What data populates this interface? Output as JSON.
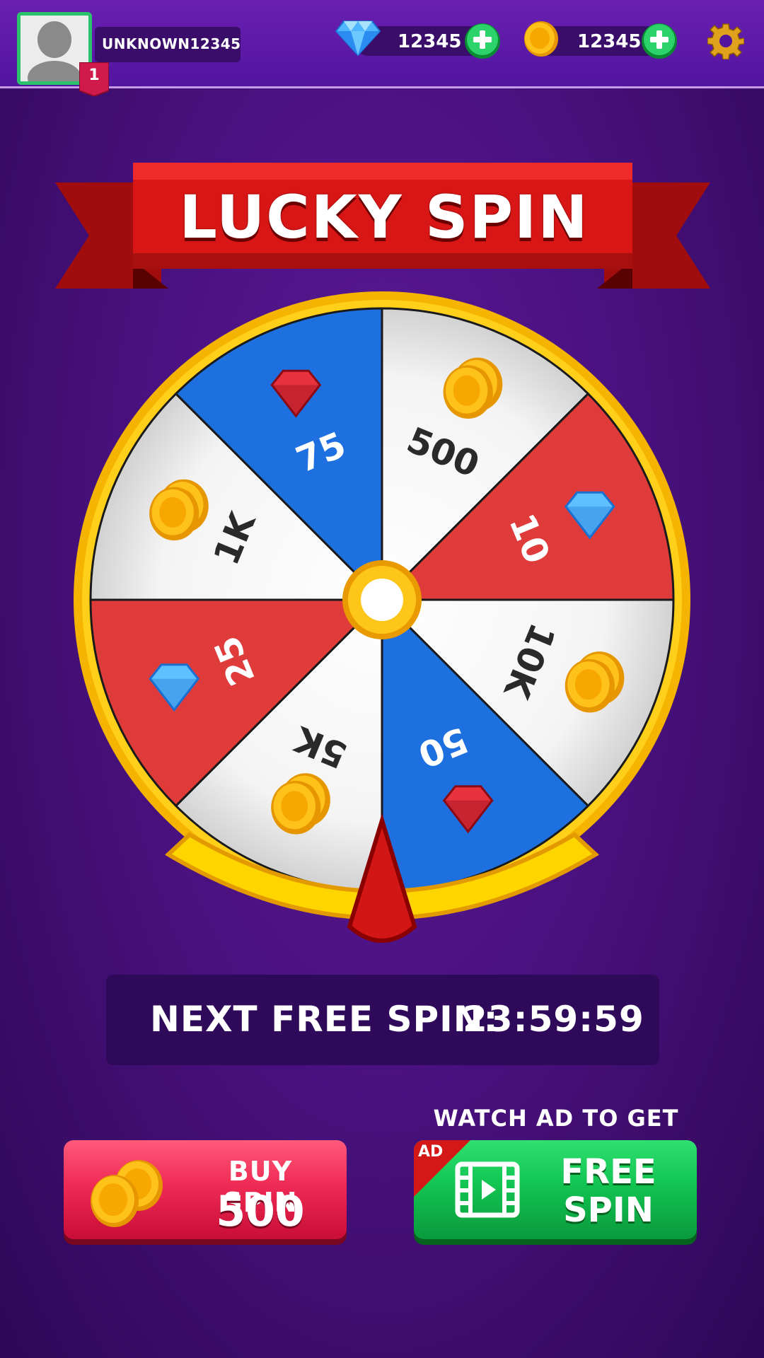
{
  "player": {
    "name": "UNKNOWN12345",
    "level": "1"
  },
  "currencies": {
    "gems": "12345",
    "coins": "12345"
  },
  "icons": {
    "gem": "diamond-icon",
    "coin": "coin-icon",
    "add": "plus-icon",
    "settings": "gear-icon",
    "video": "video-icon"
  },
  "banner": {
    "title": "LUCKY SPIN"
  },
  "wheel": {
    "segments": [
      {
        "label": "500",
        "reward": "coins",
        "color": "#ffffff"
      },
      {
        "label": "10",
        "reward": "gems",
        "color": "#e03b3b"
      },
      {
        "label": "10K",
        "reward": "coins",
        "color": "#ffffff"
      },
      {
        "label": "50",
        "reward": "rubies",
        "color": "#1e6fe0"
      },
      {
        "label": "5K",
        "reward": "coins",
        "color": "#ffffff"
      },
      {
        "label": "25",
        "reward": "gems",
        "color": "#e03b3b"
      },
      {
        "label": "1K",
        "reward": "coins",
        "color": "#ffffff"
      },
      {
        "label": "75",
        "reward": "rubies",
        "color": "#1e6fe0"
      }
    ]
  },
  "timer": {
    "label": "NEXT FREE SPIN:",
    "value": "23:59:59"
  },
  "buy_spin": {
    "label": "BUY SPIN",
    "price": "500"
  },
  "ad_spin": {
    "caption": "WATCH AD TO GET",
    "badge": "AD",
    "line1": "FREE",
    "line2": "SPIN"
  },
  "colors": {
    "background": "#4a1180",
    "wheel_rim": "#f5b400",
    "buy_button": "#ef2b55",
    "ad_button": "#12c452",
    "pointer": "#d21616"
  }
}
